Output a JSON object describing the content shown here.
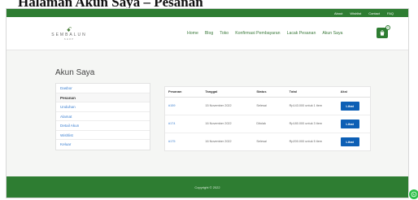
{
  "heading": "Halaman Akun Saya – Pesanan",
  "topbar": {
    "links": [
      "About",
      "Wishlist",
      "Contact",
      "FAQ"
    ]
  },
  "logo": {
    "mark": "ꗃ",
    "name": "SEMBALUN",
    "tagline": "SHOP"
  },
  "nav": {
    "items": [
      "Home",
      "Blog",
      "Toko",
      "Konfirmasi Pembayaran",
      "Lacak Pesanan",
      "Akun Saya"
    ]
  },
  "cart": {
    "icon": "cart-icon",
    "count": "0"
  },
  "account": {
    "title": "Akun Saya",
    "sidebar": [
      "Dasbor",
      "Pesanan",
      "Unduhan",
      "Alamat",
      "Detail Akun",
      "Wishlist",
      "Keluar"
    ],
    "active_index": 1
  },
  "orders": {
    "columns": [
      "Pesanan",
      "Tanggal",
      "Status",
      "Total",
      "Aksi"
    ],
    "rows": [
      {
        "id": "#159",
        "date": "15 November 2022",
        "status": "Selesai",
        "total": "Rp143.000 untuk 1 item",
        "action": "Lihat"
      },
      {
        "id": "#174",
        "date": "16 November 2022",
        "status": "Ditolak",
        "total": "Rp180.000 untuk 3 item",
        "action": "Lihat"
      },
      {
        "id": "#175",
        "date": "16 November 2022",
        "status": "Selesai",
        "total": "Rp200.000 untuk 5 item",
        "action": "Lihat"
      }
    ]
  },
  "footer": {
    "copyright": "Copyright © 2022"
  },
  "colors": {
    "brand_green": "#2e7d32",
    "button_blue": "#0d5fb5",
    "link_blue": "#3b7fd0"
  },
  "floating": {
    "icon": "whatsapp-icon"
  }
}
